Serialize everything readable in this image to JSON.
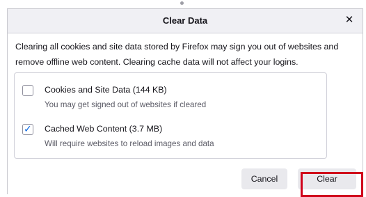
{
  "dialog": {
    "title": "Clear Data",
    "close_glyph": "✕",
    "description": "Clearing all cookies and site data stored by Firefox may sign you out of websites and remove offline web content. Clearing cache data will not affect your logins.",
    "options": [
      {
        "label": "Cookies and Site Data (144 KB)",
        "subtext": "You may get signed out of websites if cleared",
        "checked": false
      },
      {
        "label": "Cached Web Content (3.7 MB)",
        "subtext": "Will require websites to reload images and data",
        "checked": true
      }
    ],
    "cancel_label": "Cancel",
    "clear_label": "Clear"
  },
  "colors": {
    "accent": "#0061e0",
    "highlight": "#d0021b",
    "titlebar": "#f0f0f4"
  },
  "icons": {
    "close": "close-icon",
    "check": "checkmark-icon"
  }
}
